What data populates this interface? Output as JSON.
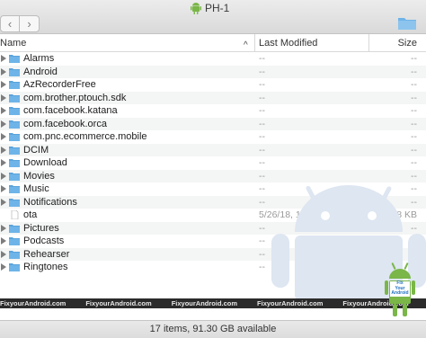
{
  "window": {
    "title": "PH-1",
    "back_glyph": "‹",
    "forward_glyph": "›"
  },
  "columns": {
    "name": "Name",
    "last_modified": "Last Modified",
    "size": "Size"
  },
  "rows": [
    {
      "name": "Alarms",
      "modified": "--",
      "size": "--",
      "kind": "folder"
    },
    {
      "name": "Android",
      "modified": "--",
      "size": "--",
      "kind": "folder"
    },
    {
      "name": "AzRecorderFree",
      "modified": "--",
      "size": "--",
      "kind": "folder"
    },
    {
      "name": "com.brother.ptouch.sdk",
      "modified": "--",
      "size": "--",
      "kind": "folder"
    },
    {
      "name": "com.facebook.katana",
      "modified": "--",
      "size": "--",
      "kind": "folder"
    },
    {
      "name": "com.facebook.orca",
      "modified": "--",
      "size": "--",
      "kind": "folder"
    },
    {
      "name": "com.pnc.ecommerce.mobile",
      "modified": "--",
      "size": "--",
      "kind": "folder"
    },
    {
      "name": "DCIM",
      "modified": "--",
      "size": "--",
      "kind": "folder"
    },
    {
      "name": "Download",
      "modified": "--",
      "size": "--",
      "kind": "folder"
    },
    {
      "name": "Movies",
      "modified": "--",
      "size": "--",
      "kind": "folder"
    },
    {
      "name": "Music",
      "modified": "--",
      "size": "--",
      "kind": "folder"
    },
    {
      "name": "Notifications",
      "modified": "--",
      "size": "--",
      "kind": "folder"
    },
    {
      "name": "ota",
      "modified": "5/26/18, 10:33 AM",
      "size": "128 KB",
      "kind": "file"
    },
    {
      "name": "Pictures",
      "modified": "--",
      "size": "--",
      "kind": "folder"
    },
    {
      "name": "Podcasts",
      "modified": "--",
      "size": "--",
      "kind": "folder"
    },
    {
      "name": "Rehearser",
      "modified": "--",
      "size": "--",
      "kind": "folder"
    },
    {
      "name": "Ringtones",
      "modified": "--",
      "size": "--",
      "kind": "folder"
    }
  ],
  "status": {
    "text": "17 items, 91.30 GB available"
  },
  "watermark": {
    "banner_text": "FixyourAndroid.com",
    "badge_lines": [
      "Fix",
      "Your",
      "Android"
    ]
  },
  "colors": {
    "folder": "#6eb4e8",
    "folder_tab": "#5aa3db",
    "android_green": "#7ab648",
    "watermark_android": "#dde6f1"
  }
}
